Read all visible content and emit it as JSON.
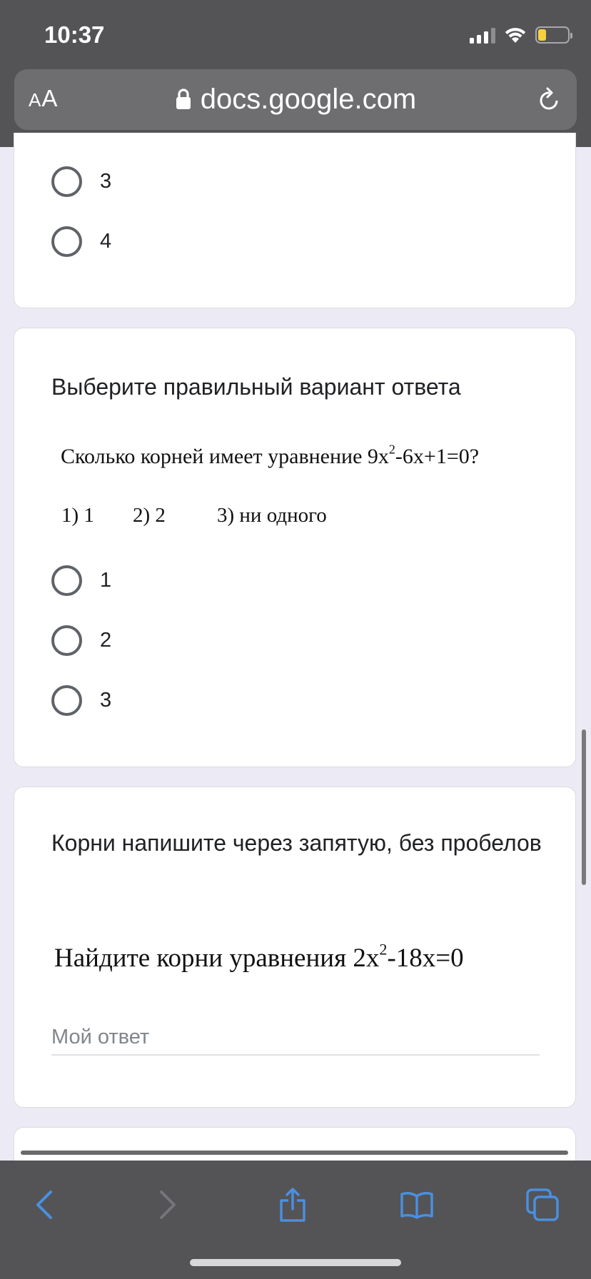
{
  "status_bar": {
    "time": "10:37",
    "icons": [
      "signal-icon",
      "wifi-icon",
      "battery-icon"
    ],
    "battery_color": "#f5d13b"
  },
  "browser": {
    "text_size_button": {
      "small": "A",
      "large": "A"
    },
    "url": "docs.google.com",
    "url_icon": "lock-icon",
    "reload_icon": "reload-icon",
    "toolbar": [
      "back-icon",
      "forward-icon",
      "share-icon",
      "bookmarks-icon",
      "tabs-icon"
    ],
    "accent": "#4a90e2"
  },
  "prev_question": {
    "options": [
      "3",
      "4"
    ]
  },
  "question_roots_count": {
    "title": "Выберите правильный вариант ответа",
    "image_text": {
      "before": "Сколько корней имеет уравнение 9x",
      "exponent": "2",
      "after": "-6x+1=0?",
      "choices": [
        "1) 1",
        "2) 2",
        "3) ни одного"
      ]
    },
    "options": [
      "1",
      "2",
      "3"
    ]
  },
  "question_find_roots": {
    "title": "Корни напишите через запятую, без пробелов",
    "image_text": {
      "before": "Найдите корни уравнения 2x",
      "exponent": "2",
      "after": "-18x=0"
    },
    "answer_placeholder": "Мой ответ",
    "answer_value": ""
  }
}
